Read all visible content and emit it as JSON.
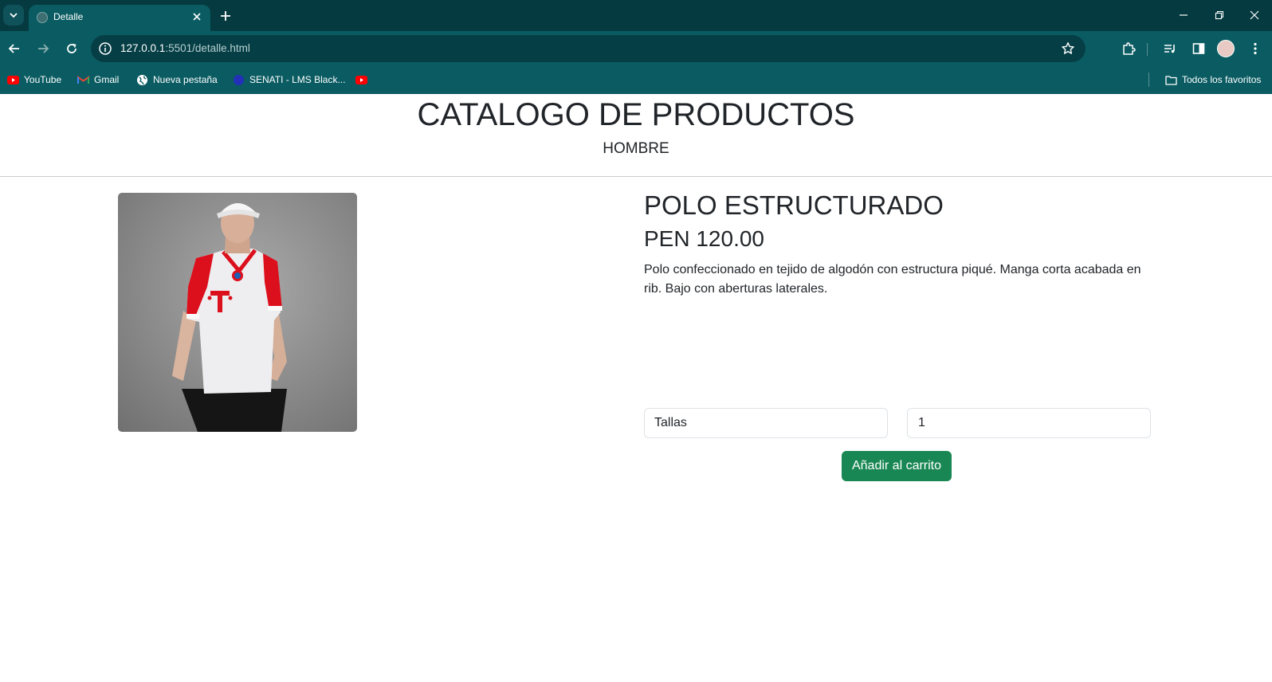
{
  "browser": {
    "tab_title": "Detalle",
    "url_host": "127.0.0.1",
    "url_rest": ":5501/detalle.html",
    "bookmarks": [
      {
        "label": "YouTube",
        "icon": "youtube-icon"
      },
      {
        "label": "Gmail",
        "icon": "gmail-icon"
      },
      {
        "label": "Nueva pestaña",
        "icon": "globe-icon"
      },
      {
        "label": "SENATI - LMS Black...",
        "icon": "senati-icon"
      },
      {
        "label": "",
        "icon": "youtube-icon"
      }
    ],
    "all_bookmarks_label": "Todos los favoritos"
  },
  "header": {
    "title": "CATALOGO DE PRODUCTOS",
    "subtitle": "HOMBRE"
  },
  "product": {
    "name": "POLO ESTRUCTURADO",
    "price": "PEN 120.00",
    "description": "Polo confeccionado en tejido de algodón con estructura piqué. Manga corta acabada en rib. Bajo con aberturas laterales.",
    "size_select_value": "Tallas",
    "quantity_value": "1",
    "add_to_cart_label": "Añadir al carrito"
  },
  "colors": {
    "chrome_dark": "#053a40",
    "chrome": "#0a5c62",
    "button_green": "#198754"
  }
}
